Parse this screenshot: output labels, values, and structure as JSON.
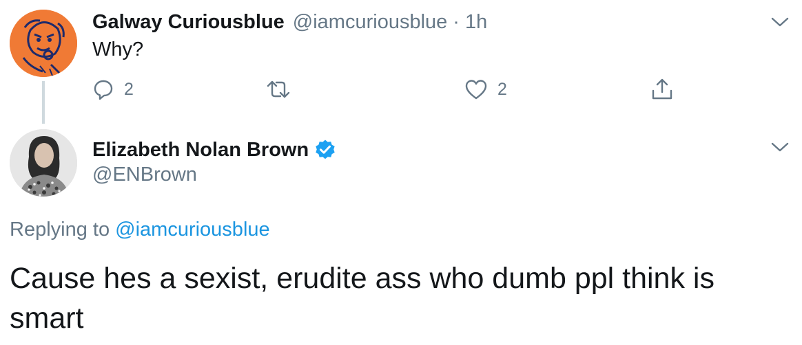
{
  "tweet1": {
    "display_name": "Galway Curiousblue",
    "handle": "@iamcuriousblue",
    "separator": "·",
    "time": "1h",
    "text": "Why?",
    "reply_count": "2",
    "like_count": "2",
    "icons": {
      "menu": "chevron-down-icon",
      "reply": "reply-icon",
      "retweet": "retweet-icon",
      "like": "heart-icon",
      "share": "share-icon"
    },
    "avatar_color": "#f07a35"
  },
  "tweet2": {
    "display_name": "Elizabeth Nolan Brown",
    "handle": "@ENBrown",
    "verified": true,
    "replying_label": "Replying to",
    "replying_to": "@iamcuriousblue",
    "text": "Cause hes a sexist, erudite ass who dumb ppl think is smart",
    "icons": {
      "menu": "chevron-down-icon",
      "verified": "verified-badge-icon"
    }
  },
  "colors": {
    "text_primary": "#14171a",
    "text_secondary": "#657786",
    "link": "#1b95e0",
    "verified": "#1da1f2"
  }
}
